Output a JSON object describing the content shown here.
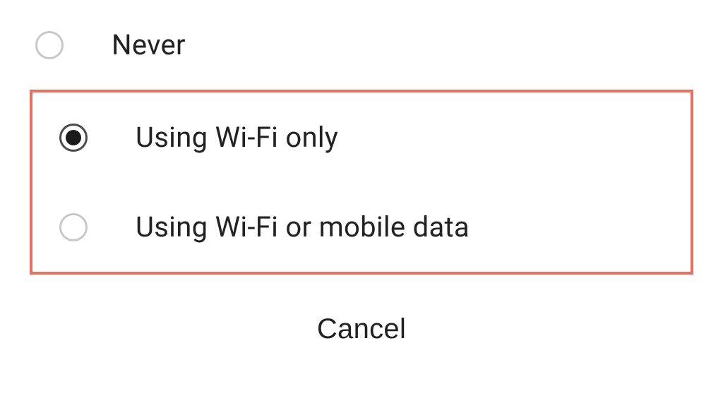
{
  "options": [
    {
      "label": "Never",
      "selected": false
    },
    {
      "label": "Using Wi-Fi only",
      "selected": true
    },
    {
      "label": "Using Wi-Fi or mobile data",
      "selected": false
    }
  ],
  "cancel_label": "Cancel",
  "highlight_color": "#e87060"
}
